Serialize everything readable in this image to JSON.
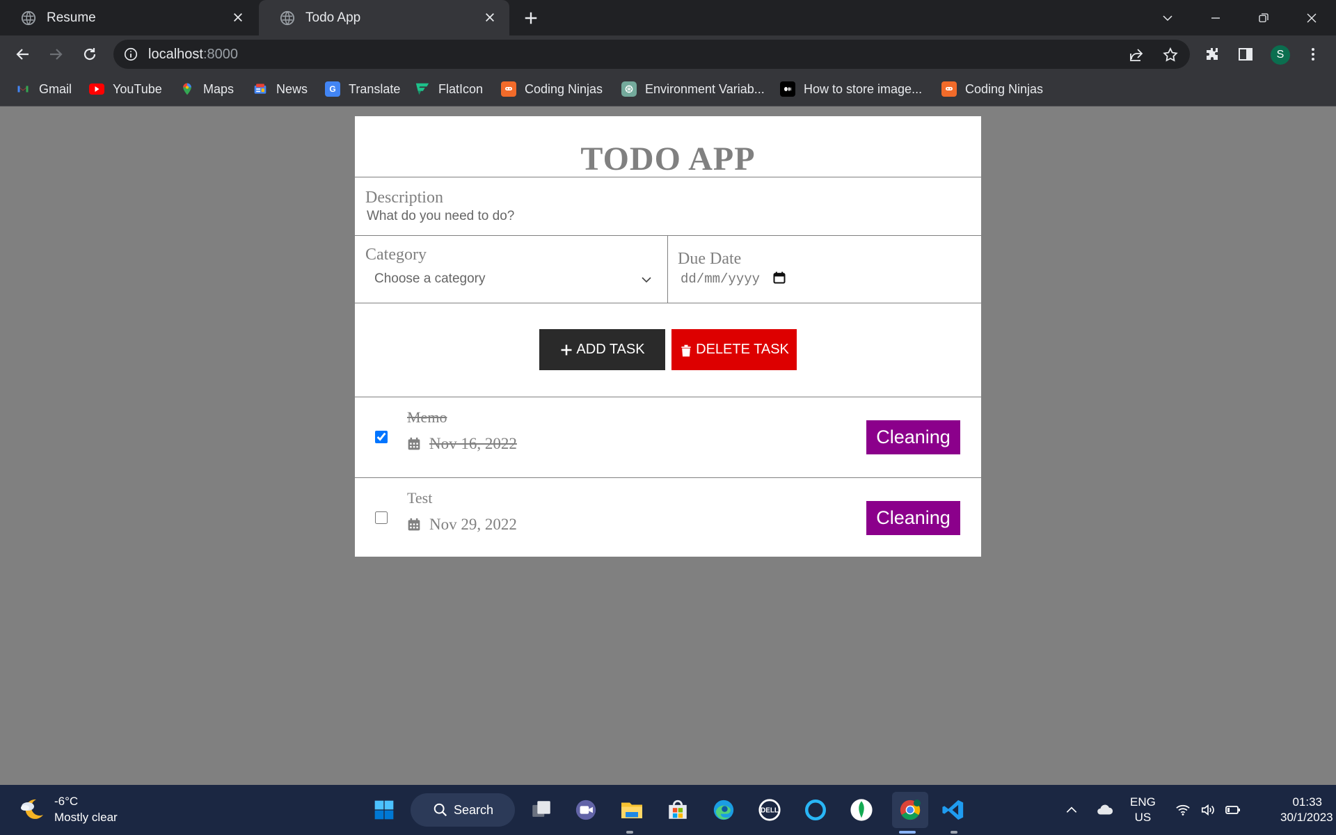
{
  "browser": {
    "tabs": [
      {
        "title": "Resume",
        "active": false
      },
      {
        "title": "Todo App",
        "active": true
      }
    ],
    "url": {
      "host": "localhost",
      "port": ":8000"
    },
    "profile_initial": "S",
    "bookmarks": [
      {
        "label": "Gmail",
        "icon": "gmail-icon"
      },
      {
        "label": "YouTube",
        "icon": "youtube-icon"
      },
      {
        "label": "Maps",
        "icon": "maps-icon"
      },
      {
        "label": "News",
        "icon": "news-icon"
      },
      {
        "label": "Translate",
        "icon": "translate-icon"
      },
      {
        "label": "FlatIcon",
        "icon": "flaticon-icon"
      },
      {
        "label": "Coding Ninjas",
        "icon": "coding-ninjas-icon"
      },
      {
        "label": "Environment Variab...",
        "icon": "openai-icon"
      },
      {
        "label": "How to store image...",
        "icon": "medium-icon"
      },
      {
        "label": "Coding Ninjas",
        "icon": "coding-ninjas-icon"
      }
    ]
  },
  "app": {
    "title": "TODO APP",
    "description_label": "Description",
    "description_placeholder": "What do you need to do?",
    "category_label": "Category",
    "category_selected": "Choose a category",
    "due_date_label": "Due Date",
    "due_date_placeholder": "dd/mm/yyyy",
    "add_button": "ADD TASK",
    "delete_button": "DELETE TASK",
    "tasks": [
      {
        "name": "Memo",
        "date": "Nov 16, 2022",
        "category": "Cleaning",
        "done": true
      },
      {
        "name": "Test",
        "date": "Nov 29, 2022",
        "category": "Cleaning",
        "done": false
      }
    ],
    "colors": {
      "tag": "#8b008b",
      "delete": "#dd0000",
      "add": "#2a2a2a",
      "page_bg": "#808080"
    }
  },
  "taskbar": {
    "weather_temp": "-6°C",
    "weather_desc": "Mostly clear",
    "search_label": "Search",
    "lang_line1": "ENG",
    "lang_line2": "US",
    "time": "01:33",
    "date": "30/1/2023"
  }
}
